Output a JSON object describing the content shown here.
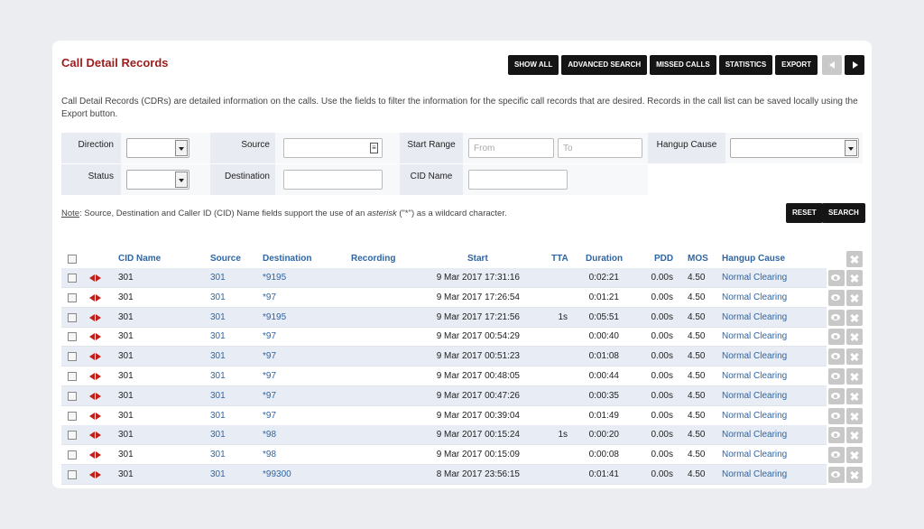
{
  "page": {
    "title": "Call Detail Records"
  },
  "toolbar": {
    "show_all": "SHOW ALL",
    "advanced_search": "ADVANCED SEARCH",
    "missed_calls": "MISSED CALLS",
    "statistics": "STATISTICS",
    "export": "EXPORT"
  },
  "description": "Call Detail Records (CDRs) are detailed information on the calls. Use the fields to filter the information for the specific call records that are desired. Records in the call list can be saved locally using the Export button.",
  "filters": {
    "direction_label": "Direction",
    "status_label": "Status",
    "source_label": "Source",
    "destination_label": "Destination",
    "start_range_label": "Start Range",
    "cid_name_label": "CID Name",
    "hangup_cause_label": "Hangup Cause",
    "from_placeholder": "From",
    "to_placeholder": "To"
  },
  "note": {
    "prefix": "Note",
    "text_a": ": Source, Destination and Caller ID (CID) Name fields support the use of an ",
    "emph": "asterisk",
    "text_b": " (\"*\") as a wildcard character."
  },
  "buttons": {
    "reset": "RESET",
    "search": "SEARCH"
  },
  "table": {
    "headers": {
      "cid_name": "CID Name",
      "source": "Source",
      "destination": "Destination",
      "recording": "Recording",
      "start": "Start",
      "tta": "TTA",
      "duration": "Duration",
      "pdd": "PDD",
      "mos": "MOS",
      "hangup_cause": "Hangup Cause"
    },
    "rows": [
      {
        "cid": "301",
        "source": "301",
        "dest": "*9195",
        "start": "9 Mar 2017 17:31:16",
        "tta": "",
        "duration": "0:02:21",
        "pdd": "0.00s",
        "mos": "4.50",
        "hangup": "Normal Clearing"
      },
      {
        "cid": "301",
        "source": "301",
        "dest": "*97",
        "start": "9 Mar 2017 17:26:54",
        "tta": "",
        "duration": "0:01:21",
        "pdd": "0.00s",
        "mos": "4.50",
        "hangup": "Normal Clearing"
      },
      {
        "cid": "301",
        "source": "301",
        "dest": "*9195",
        "start": "9 Mar 2017 17:21:56",
        "tta": "1s",
        "duration": "0:05:51",
        "pdd": "0.00s",
        "mos": "4.50",
        "hangup": "Normal Clearing"
      },
      {
        "cid": "301",
        "source": "301",
        "dest": "*97",
        "start": "9 Mar 2017 00:54:29",
        "tta": "",
        "duration": "0:00:40",
        "pdd": "0.00s",
        "mos": "4.50",
        "hangup": "Normal Clearing"
      },
      {
        "cid": "301",
        "source": "301",
        "dest": "*97",
        "start": "9 Mar 2017 00:51:23",
        "tta": "",
        "duration": "0:01:08",
        "pdd": "0.00s",
        "mos": "4.50",
        "hangup": "Normal Clearing"
      },
      {
        "cid": "301",
        "source": "301",
        "dest": "*97",
        "start": "9 Mar 2017 00:48:05",
        "tta": "",
        "duration": "0:00:44",
        "pdd": "0.00s",
        "mos": "4.50",
        "hangup": "Normal Clearing"
      },
      {
        "cid": "301",
        "source": "301",
        "dest": "*97",
        "start": "9 Mar 2017 00:47:26",
        "tta": "",
        "duration": "0:00:35",
        "pdd": "0.00s",
        "mos": "4.50",
        "hangup": "Normal Clearing"
      },
      {
        "cid": "301",
        "source": "301",
        "dest": "*97",
        "start": "9 Mar 2017 00:39:04",
        "tta": "",
        "duration": "0:01:49",
        "pdd": "0.00s",
        "mos": "4.50",
        "hangup": "Normal Clearing"
      },
      {
        "cid": "301",
        "source": "301",
        "dest": "*98",
        "start": "9 Mar 2017 00:15:24",
        "tta": "1s",
        "duration": "0:00:20",
        "pdd": "0.00s",
        "mos": "4.50",
        "hangup": "Normal Clearing"
      },
      {
        "cid": "301",
        "source": "301",
        "dest": "*98",
        "start": "9 Mar 2017 00:15:09",
        "tta": "",
        "duration": "0:00:08",
        "pdd": "0.00s",
        "mos": "4.50",
        "hangup": "Normal Clearing"
      },
      {
        "cid": "301",
        "source": "301",
        "dest": "*99300",
        "start": "8 Mar 2017 23:56:15",
        "tta": "",
        "duration": "0:01:41",
        "pdd": "0.00s",
        "mos": "4.50",
        "hangup": "Normal Clearing"
      }
    ]
  }
}
